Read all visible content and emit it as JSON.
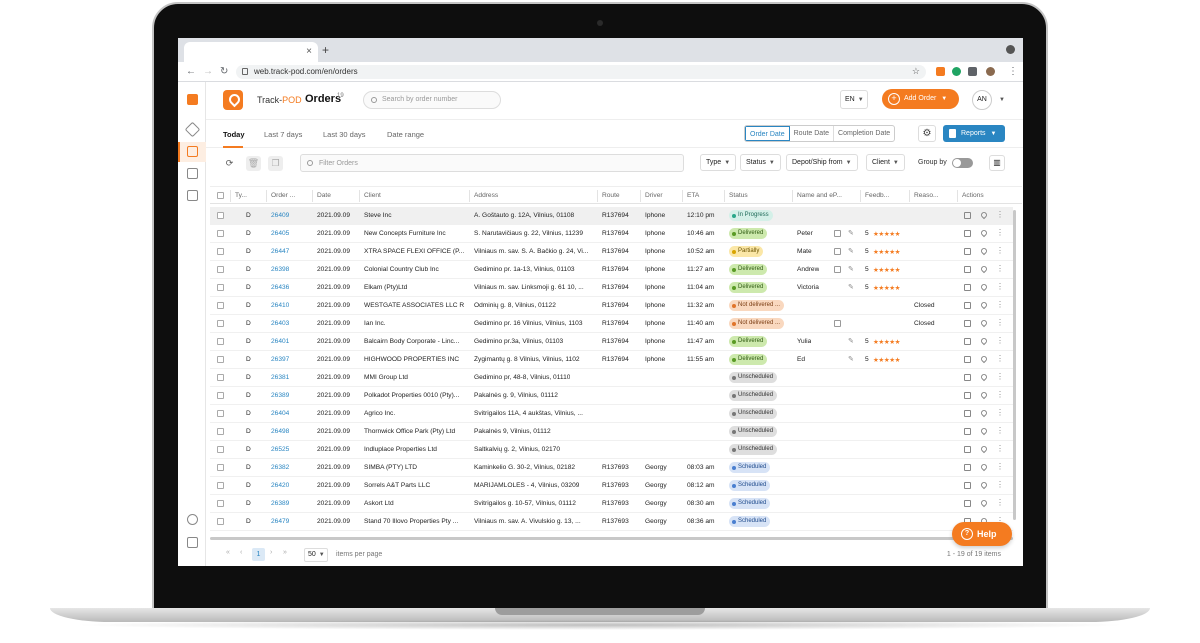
{
  "browser": {
    "tab_close": "×",
    "new_tab": "+",
    "url": "web.track-pod.com/en/orders"
  },
  "header": {
    "brand_prefix": "Track-",
    "brand_suffix": "POD",
    "title": "Orders",
    "count": "19",
    "search_placeholder": "Search by order number",
    "language": "EN",
    "add_order_label": "Add Order",
    "avatar_initials": "AN"
  },
  "period_tabs": [
    "Today",
    "Last 7 days",
    "Last 30 days",
    "Date range"
  ],
  "date_types": [
    "Order Date",
    "Route Date",
    "Completion Date"
  ],
  "reports_label": "Reports",
  "toolbar": {
    "filter_placeholder": "Filter Orders",
    "filters": [
      "Type",
      "Status",
      "Depot/Ship from",
      "Client"
    ],
    "group_by_label": "Group by"
  },
  "columns": [
    "Ty...",
    "Order ...",
    "Date",
    "Client",
    "Address",
    "Route",
    "Driver",
    "ETA",
    "Status",
    "Name and eP...",
    "Feedb...",
    "Reaso...",
    "Actions"
  ],
  "rows": [
    {
      "type": "D",
      "order": "26409",
      "date": "2021.09.09",
      "client": "Steve Inc",
      "address": "A. Goštauto g. 12A, Vilnius, 01108",
      "route": "R137694",
      "driver": "Iphone",
      "eta": "12:10 pm",
      "status": "In Progress",
      "status_key": "in_progress",
      "name": "",
      "rating": "",
      "stars": "",
      "reason": "",
      "photo": false,
      "sign": false
    },
    {
      "type": "D",
      "order": "26405",
      "date": "2021.09.09",
      "client": "New Concepts Furniture Inc",
      "address": "S. Narutavičiaus g. 22, Vilnius, 11239",
      "route": "R137694",
      "driver": "Iphone",
      "eta": "10:46 am",
      "status": "Delivered",
      "status_key": "delivered",
      "name": "Peter",
      "rating": "5",
      "stars": "★★★★★",
      "reason": "",
      "photo": true,
      "sign": true
    },
    {
      "type": "D",
      "order": "26447",
      "date": "2021.09.09",
      "client": "XTRA SPACE FLEXI OFFICE (P...",
      "address": "Vilniaus m. sav. S. A. Bačkio g. 24, Vi...",
      "route": "R137694",
      "driver": "Iphone",
      "eta": "10:52 am",
      "status": "Partially",
      "status_key": "partially",
      "name": "Mate",
      "rating": "5",
      "stars": "★★★★★",
      "reason": "",
      "photo": true,
      "sign": true
    },
    {
      "type": "D",
      "order": "26398",
      "date": "2021.09.09",
      "client": "Colonial Country Club Inc",
      "address": "Gedimino pr. 1a-13, Vilnius, 01103",
      "route": "R137694",
      "driver": "Iphone",
      "eta": "11:27 am",
      "status": "Delivered",
      "status_key": "delivered",
      "name": "Andrew",
      "rating": "5",
      "stars": "★★★★★",
      "reason": "",
      "photo": true,
      "sign": true
    },
    {
      "type": "D",
      "order": "26436",
      "date": "2021.09.09",
      "client": "Elkam (Pty)Ltd",
      "address": "Vilniaus m. sav. Linksmoji g. 61 10, ...",
      "route": "R137694",
      "driver": "Iphone",
      "eta": "11:04 am",
      "status": "Delivered",
      "status_key": "delivered",
      "name": "Victoria",
      "rating": "5",
      "stars": "★★★★★",
      "reason": "",
      "photo": false,
      "sign": true
    },
    {
      "type": "D",
      "order": "26410",
      "date": "2021.09.09",
      "client": "WESTGATE ASSOCIATES LLC R",
      "address": "Odminių g. 8, Vilnius, 01122",
      "route": "R137694",
      "driver": "Iphone",
      "eta": "11:32 am",
      "status": "Not delivered ...",
      "status_key": "not_delivered",
      "name": "",
      "rating": "",
      "stars": "",
      "reason": "Closed",
      "photo": false,
      "sign": false
    },
    {
      "type": "D",
      "order": "26403",
      "date": "2021.09.09",
      "client": "Ian Inc.",
      "address": "Gedimino pr. 16 Vilnius, Vilnius, 1103",
      "route": "R137694",
      "driver": "Iphone",
      "eta": "11:40 am",
      "status": "Not delivered ...",
      "status_key": "not_delivered",
      "name": "",
      "rating": "",
      "stars": "",
      "reason": "Closed",
      "photo": true,
      "sign": false
    },
    {
      "type": "D",
      "order": "26401",
      "date": "2021.09.09",
      "client": "Balcairn Body Corporate - Linc...",
      "address": "Gedimino pr.3a, Vilnius, 01103",
      "route": "R137694",
      "driver": "Iphone",
      "eta": "11:47 am",
      "status": "Delivered",
      "status_key": "delivered",
      "name": "Yulia",
      "rating": "5",
      "stars": "★★★★★",
      "reason": "",
      "photo": false,
      "sign": true
    },
    {
      "type": "D",
      "order": "26397",
      "date": "2021.09.09",
      "client": "HIGHWOOD PROPERTIES INC",
      "address": "Žygimantų g. 8 Vilnius, Vilnius, 1102",
      "route": "R137694",
      "driver": "Iphone",
      "eta": "11:55 am",
      "status": "Delivered",
      "status_key": "delivered",
      "name": "Ed",
      "rating": "5",
      "stars": "★★★★★",
      "reason": "",
      "photo": false,
      "sign": true
    },
    {
      "type": "D",
      "order": "26381",
      "date": "2021.09.09",
      "client": "MMI Group Ltd",
      "address": "Gedimino pr, 48-8, Vilnius, 01110",
      "route": "",
      "driver": "",
      "eta": "",
      "status": "Unscheduled",
      "status_key": "unscheduled",
      "name": "",
      "rating": "",
      "stars": "",
      "reason": "",
      "photo": false,
      "sign": false
    },
    {
      "type": "D",
      "order": "26389",
      "date": "2021.09.09",
      "client": "Polkadot Properties 0010 (Pty)...",
      "address": "Pakalnės g. 9, Vilnius, 01112",
      "route": "",
      "driver": "",
      "eta": "",
      "status": "Unscheduled",
      "status_key": "unscheduled",
      "name": "",
      "rating": "",
      "stars": "",
      "reason": "",
      "photo": false,
      "sign": false
    },
    {
      "type": "D",
      "order": "26404",
      "date": "2021.09.09",
      "client": "Agrico Inc.",
      "address": "Švitrigailos 11A, 4 aukštas, Vilnius, ...",
      "route": "",
      "driver": "",
      "eta": "",
      "status": "Unscheduled",
      "status_key": "unscheduled",
      "name": "",
      "rating": "",
      "stars": "",
      "reason": "",
      "photo": false,
      "sign": false
    },
    {
      "type": "D",
      "order": "26498",
      "date": "2021.09.09",
      "client": "Thornwick Office Park (Pty) Ltd",
      "address": "Pakalnės 9, Vilnius, 01112",
      "route": "",
      "driver": "",
      "eta": "",
      "status": "Unscheduled",
      "status_key": "unscheduled",
      "name": "",
      "rating": "",
      "stars": "",
      "reason": "",
      "photo": false,
      "sign": false
    },
    {
      "type": "D",
      "order": "26525",
      "date": "2021.09.09",
      "client": "Indluplace Properties Ltd",
      "address": "Šaltkalvių g. 2, Vilnius, 02170",
      "route": "",
      "driver": "",
      "eta": "",
      "status": "Unscheduled",
      "status_key": "unscheduled",
      "name": "",
      "rating": "",
      "stars": "",
      "reason": "",
      "photo": false,
      "sign": false
    },
    {
      "type": "D",
      "order": "26382",
      "date": "2021.09.09",
      "client": "SIMBA (PTY) LTD",
      "address": "Kaminkelio G. 30-2, Vilnius, 02182",
      "route": "R137693",
      "driver": "Georgy",
      "eta": "08:03 am",
      "status": "Scheduled",
      "status_key": "scheduled",
      "name": "",
      "rating": "",
      "stars": "",
      "reason": "",
      "photo": false,
      "sign": false
    },
    {
      "type": "D",
      "order": "26420",
      "date": "2021.09.09",
      "client": "Sorrels A&T Parts LLC",
      "address": "MARIJAMLOLĖS - 4, Vilnius, 03209",
      "route": "R137693",
      "driver": "Georgy",
      "eta": "08:12 am",
      "status": "Scheduled",
      "status_key": "scheduled",
      "name": "",
      "rating": "",
      "stars": "",
      "reason": "",
      "photo": false,
      "sign": false
    },
    {
      "type": "D",
      "order": "26389",
      "date": "2021.09.09",
      "client": "Askort Ltd",
      "address": "Švitrigailos g. 10-57, Vilnius, 01112",
      "route": "R137693",
      "driver": "Georgy",
      "eta": "08:30 am",
      "status": "Scheduled",
      "status_key": "scheduled",
      "name": "",
      "rating": "",
      "stars": "",
      "reason": "",
      "photo": false,
      "sign": false
    },
    {
      "type": "D",
      "order": "26479",
      "date": "2021.09.09",
      "client": "Stand 70 Illovo Properties Pty ...",
      "address": "Vilniaus m. sav. A. Vivulskio g. 13, ...",
      "route": "R137693",
      "driver": "Georgy",
      "eta": "08:36 am",
      "status": "Scheduled",
      "status_key": "scheduled",
      "name": "",
      "rating": "",
      "stars": "",
      "reason": "",
      "photo": false,
      "sign": false
    }
  ],
  "pagination": {
    "first": "«",
    "prev": "‹",
    "current": "1",
    "next": "›",
    "last": "»",
    "per_page": "50",
    "per_page_label": "items per page",
    "range": "1 - 19 of 19 items"
  },
  "help_label": "Help",
  "colors": {
    "accent": "#f47b20",
    "link": "#2a86c2"
  }
}
